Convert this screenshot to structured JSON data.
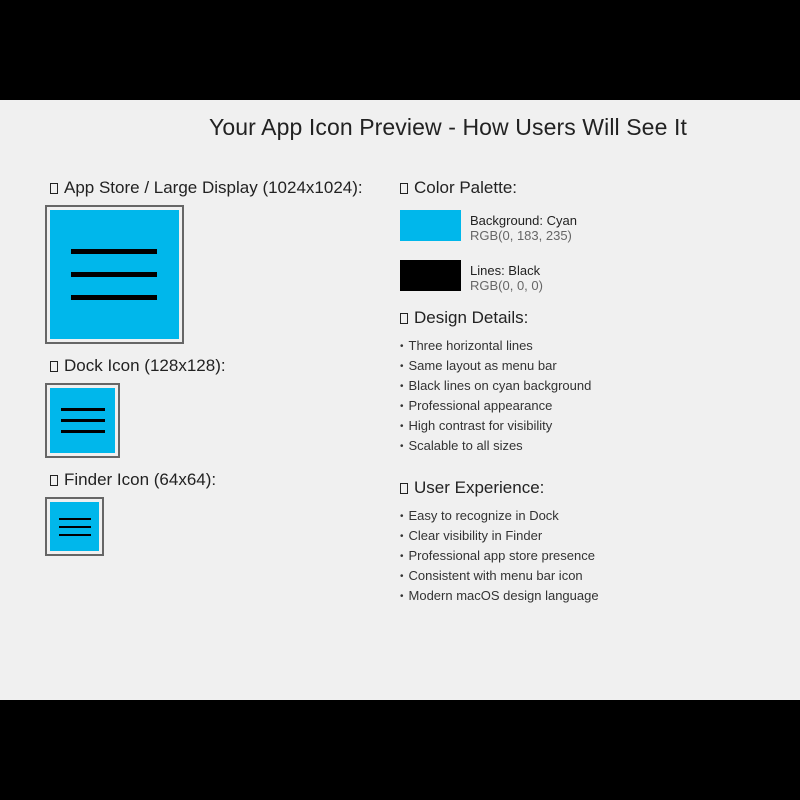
{
  "title": "Your App Icon Preview - How Users Will See It",
  "previews": {
    "large": {
      "heading": "App Store / Large Display (1024x1024):"
    },
    "dock": {
      "heading": "Dock Icon (128x128):"
    },
    "finder": {
      "heading": "Finder Icon (64x64):"
    }
  },
  "palette": {
    "heading": "Color Palette:",
    "background": {
      "label": "Background: Cyan",
      "rgb": "RGB(0, 183, 235)",
      "color": "#00b7eb"
    },
    "lines": {
      "label": "Lines: Black",
      "rgb": "RGB(0, 0, 0)",
      "color": "#000000"
    }
  },
  "design_details": {
    "heading": "Design Details:",
    "items": [
      "Three horizontal lines",
      "Same layout as menu bar",
      "Black lines on cyan background",
      "Professional appearance",
      "High contrast for visibility",
      "Scalable to all sizes"
    ]
  },
  "user_experience": {
    "heading": "User Experience:",
    "items": [
      "Easy to recognize in Dock",
      "Clear visibility in Finder",
      "Professional app store presence",
      "Consistent with menu bar icon",
      "Modern macOS design language"
    ]
  }
}
